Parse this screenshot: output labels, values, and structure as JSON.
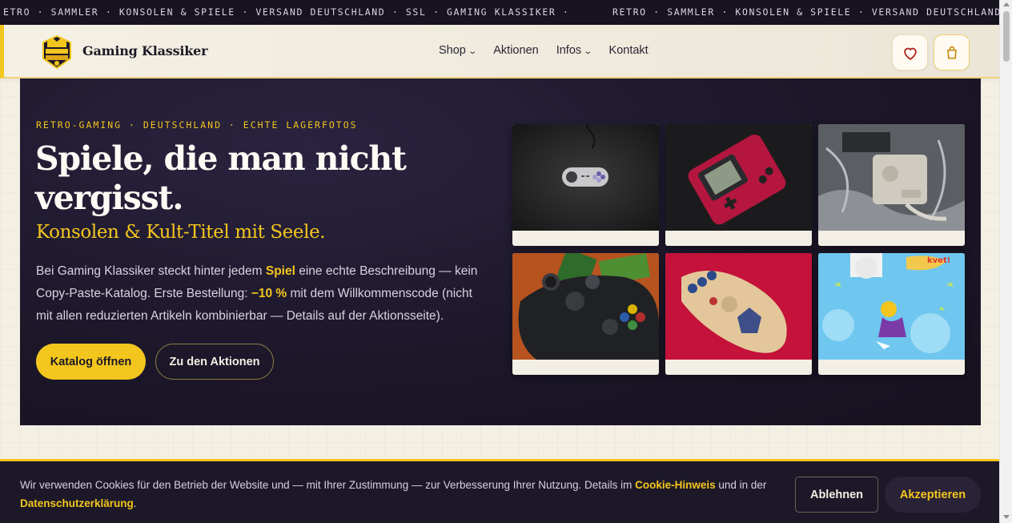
{
  "ticker": {
    "text_a": "ETRO · SAMMLER · KONSOLEN & SPIELE · VERSAND DEUTSCHLAND · SSL · GAMING KLASSIKER ·",
    "text_b": "RETRO · SAMMLER · KONSOLEN & SPIELE · VERSAND DEUTSCHLAND"
  },
  "header": {
    "brand": "Gaming Klassiker",
    "logo_icon": "gaming-klassiker-logo",
    "nav": [
      {
        "label": "Shop",
        "dropdown": true
      },
      {
        "label": "Aktionen",
        "dropdown": false
      },
      {
        "label": "Infos",
        "dropdown": true
      },
      {
        "label": "Kontakt",
        "dropdown": false
      }
    ],
    "wishlist_icon": "heart-icon",
    "cart_icon": "shopping-bag-icon"
  },
  "hero": {
    "kicker": "RETRO-GAMING · DEUTSCHLAND · ECHTE LAGERFOTOS",
    "headline": "Spiele, die man nicht vergisst.",
    "subhead": "Konsolen & Kult-Titel mit Seele.",
    "body": {
      "part1": "Bei Gaming Klassiker steckt hinter jedem ",
      "highlight1": "Spiel",
      "part2": " eine echte Beschreibung — kein Copy-Paste-Katalog. Erste Bestellung: ",
      "highlight2": "−10 %",
      "part3": " mit dem Willkommenscode (nicht mit allen reduzierten Artikeln kombinierbar — Details auf der Aktionsseite)."
    },
    "primary_button": "Katalog öffnen",
    "secondary_button": "Zu den Aktionen",
    "gallery": [
      {
        "name": "snes-controller-photo"
      },
      {
        "name": "gameboy-color-photo"
      },
      {
        "name": "dreamcast-console-photo"
      },
      {
        "name": "xbox-controller-photo"
      },
      {
        "name": "zelda-controller-photo"
      },
      {
        "name": "rayman-game-art-photo"
      }
    ]
  },
  "cookie": {
    "text_before": "Wir verwenden Cookies für den Betrieb der Website und — mit Ihrer Zustimmung — zur Verbesserung Ihrer Nutzung. Details im ",
    "link1": "Cookie-Hinweis",
    "text_middle": " und in der ",
    "link2": "Datenschutzerklärung",
    "text_after": ".",
    "decline": "Ablehnen",
    "accept": "Akzeptieren"
  },
  "colors": {
    "accent": "#f3c61d",
    "hero_bg": "#1c1729",
    "page_bg": "#f3efe3"
  }
}
